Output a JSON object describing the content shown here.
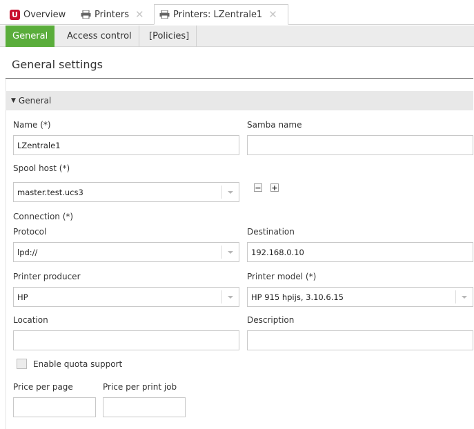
{
  "tabs": [
    {
      "label": "Overview"
    },
    {
      "label": "Printers"
    },
    {
      "label": "Printers: LZentrale1"
    }
  ],
  "subtabs": [
    "General",
    "Access control",
    "[Policies]"
  ],
  "page_title": "General settings",
  "section_title": "General",
  "fields": {
    "name": {
      "label": "Name (*)",
      "value": "LZentrale1"
    },
    "samba_name": {
      "label": "Samba name",
      "value": ""
    },
    "spool_host": {
      "label": "Spool host (*)",
      "value": "master.test.ucs3"
    },
    "connection": {
      "label": "Connection (*)"
    },
    "protocol": {
      "label": "Protocol",
      "value": "lpd://"
    },
    "destination": {
      "label": "Destination",
      "value": "192.168.0.10"
    },
    "printer_producer": {
      "label": "Printer producer",
      "value": "HP"
    },
    "printer_model": {
      "label": "Printer model (*)",
      "value": "HP 915 hpijs, 3.10.6.15"
    },
    "location": {
      "label": "Location",
      "value": ""
    },
    "description": {
      "label": "Description",
      "value": ""
    },
    "quota": {
      "label": "Enable quota support",
      "checked": false
    },
    "price_per_page": {
      "label": "Price per page",
      "value": ""
    },
    "price_per_job": {
      "label": "Price per print job",
      "value": ""
    }
  },
  "icons": {
    "logo": "U",
    "close": "✕",
    "remove": "−",
    "add": "+",
    "expand": "▼"
  },
  "colors": {
    "active_subtab": "#5aad3b",
    "logo": "#c8102e"
  }
}
